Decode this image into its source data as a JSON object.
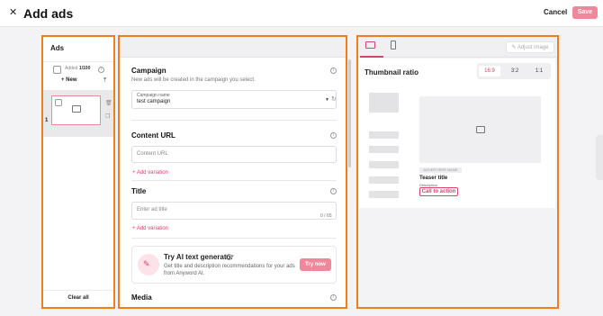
{
  "header": {
    "close_icon": "close-icon",
    "title": "Add ads",
    "cancel_label": "Cancel",
    "save_label": "Save"
  },
  "ads_panel": {
    "title": "Ads",
    "added_label": "Added",
    "added_count": "1/100",
    "new_label": "+ New",
    "ad_number": "1",
    "clear_all_label": "Clear all"
  },
  "campaign": {
    "title": "Campaign",
    "subtitle": "New ads will be created in the campaign you select.",
    "field_label": "Campaign name",
    "field_value": "test campaign"
  },
  "content_url": {
    "title": "Content URL",
    "placeholder": "Content URL",
    "add_variation": "+ Add variation"
  },
  "title_section": {
    "title": "Title",
    "placeholder": "Enter ad title",
    "counter": "0 / 65",
    "add_variation": "+ Add variation"
  },
  "ai_generator": {
    "title": "Try AI text generator",
    "description": "Get title and description recommendations for your ads from Anyword AI.",
    "button": "Try now"
  },
  "media": {
    "title": "Media"
  },
  "preview": {
    "adjust_label": "Adjust image",
    "ratio_title": "Thumbnail ratio",
    "ratios": [
      "16:9",
      "3:2",
      "1:1"
    ],
    "selected_ratio": "16:9",
    "advertiser_name": "ADVERTISER NAME",
    "teaser_title": "Teaser title",
    "description": "Description",
    "cta": "Call to action"
  },
  "colors": {
    "accent": "#d9426a",
    "save": "#f0879a",
    "highlight": "#f07f1a"
  }
}
